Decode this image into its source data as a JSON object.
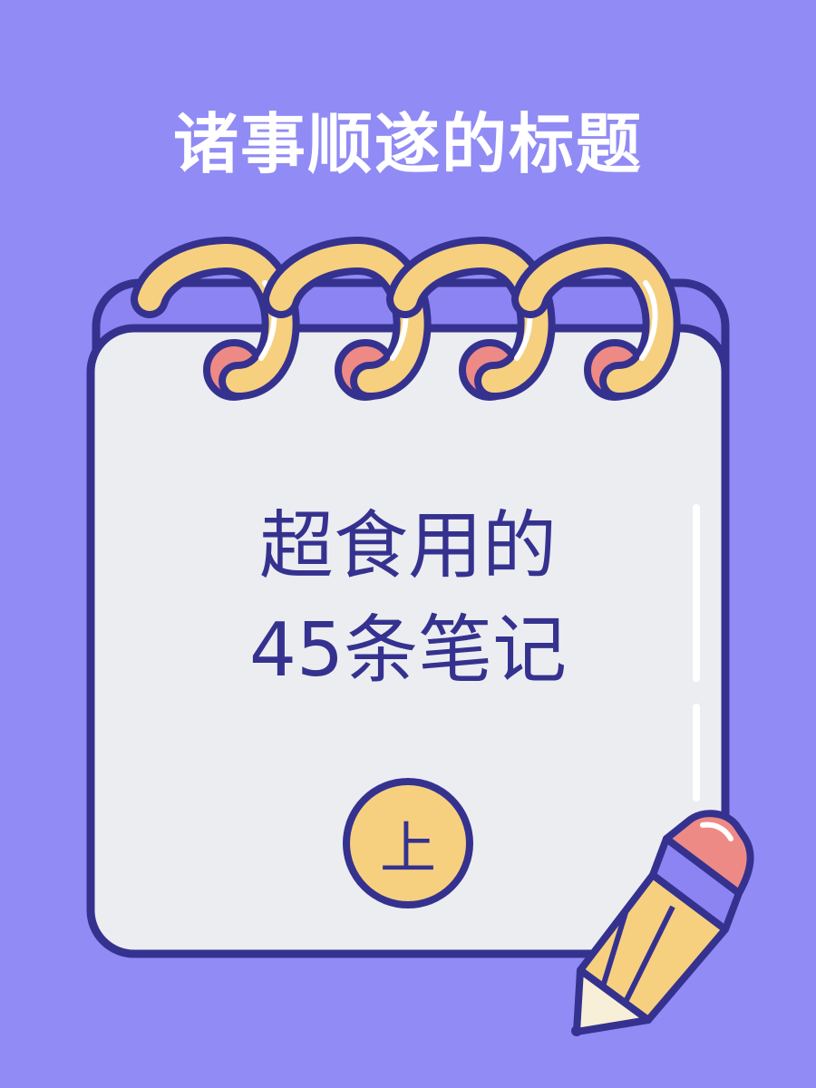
{
  "page": {
    "background_color": "#918bf5"
  },
  "header": {
    "title": "诸事顺遂的标题"
  },
  "notepad": {
    "line1": "超食用的",
    "line2": "45条笔记",
    "badge": "上",
    "colors": {
      "paper": "#ecedf1",
      "outline": "#35328f",
      "top_band": "#8b84f2",
      "ring": "#f6d07f",
      "hole": "#ee8a86",
      "badge_fill": "#f6d07f"
    }
  }
}
